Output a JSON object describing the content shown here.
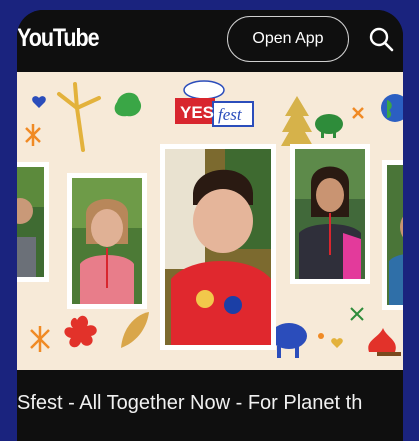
{
  "header": {
    "logo_text": "YouTube",
    "open_app_label": "Open App",
    "search_icon": "search-icon"
  },
  "video": {
    "banner_text_1": "YES",
    "banner_text_2": "fest",
    "title": "Sfest - All Together Now - For Planet th"
  },
  "colors": {
    "app_background": "#0f0f0f",
    "outer_background": "#1a237e",
    "thumbnail_background": "#f7ead8",
    "title_text": "#f1f1f1"
  }
}
